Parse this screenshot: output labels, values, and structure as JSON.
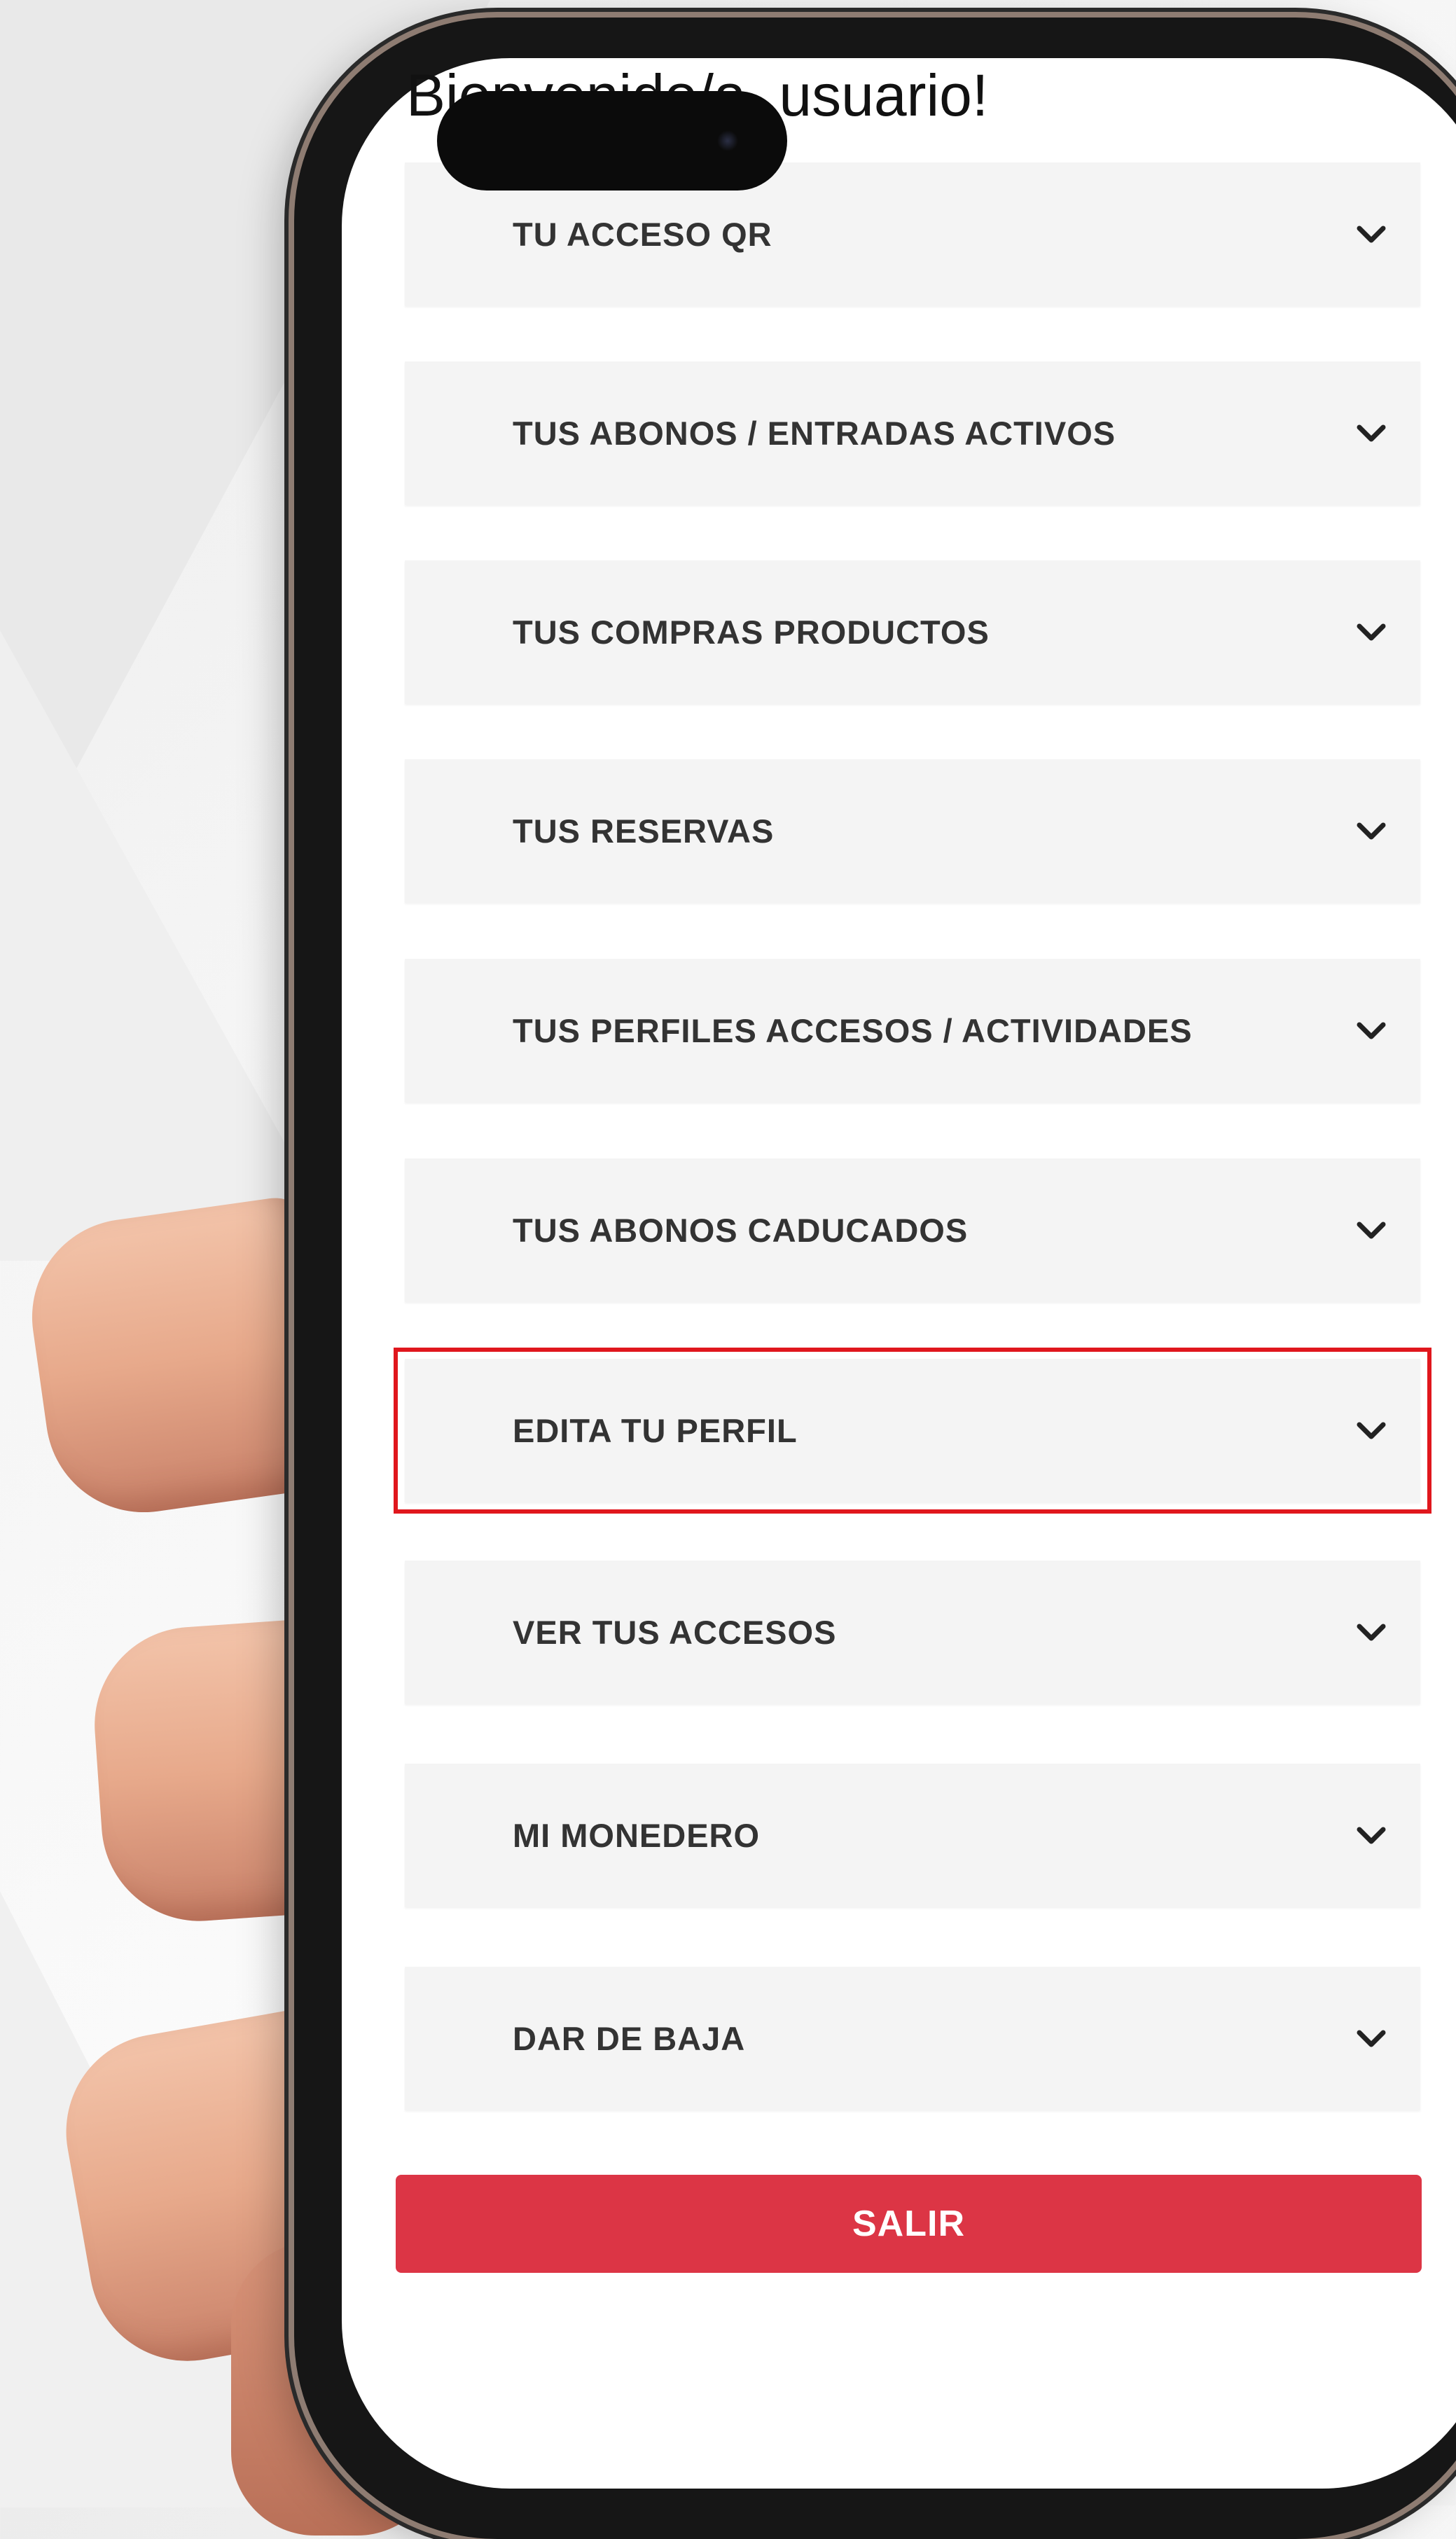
{
  "header": {
    "welcome_text": "Bienvenido/a, usuario!"
  },
  "menu": {
    "items": [
      {
        "label": "TU ACCESO QR",
        "icon": "chevron-down-icon"
      },
      {
        "label": "TUS ABONOS / ENTRADAS ACTIVOS",
        "icon": "chevron-down-icon"
      },
      {
        "label": "TUS COMPRAS PRODUCTOS",
        "icon": "chevron-down-icon"
      },
      {
        "label": "TUS RESERVAS",
        "icon": "chevron-down-icon"
      },
      {
        "label": "TUS PERFILES ACCESOS / ACTIVIDADES",
        "icon": "chevron-down-icon"
      },
      {
        "label": "TUS ABONOS CADUCADOS",
        "icon": "chevron-down-icon"
      },
      {
        "label": "EDITA TU PERFIL",
        "icon": "chevron-down-icon",
        "highlighted": true
      },
      {
        "label": "VER TUS ACCESOS",
        "icon": "chevron-down-icon"
      },
      {
        "label": "MI MONEDERO",
        "icon": "chevron-down-icon"
      },
      {
        "label": "DAR DE BAJA",
        "icon": "chevron-down-icon"
      }
    ]
  },
  "logout": {
    "label": "SALIR"
  },
  "colors": {
    "accent_red": "#dc3545",
    "highlight_border": "#e0171d",
    "item_background": "#f4f4f4",
    "item_text": "#333333"
  }
}
